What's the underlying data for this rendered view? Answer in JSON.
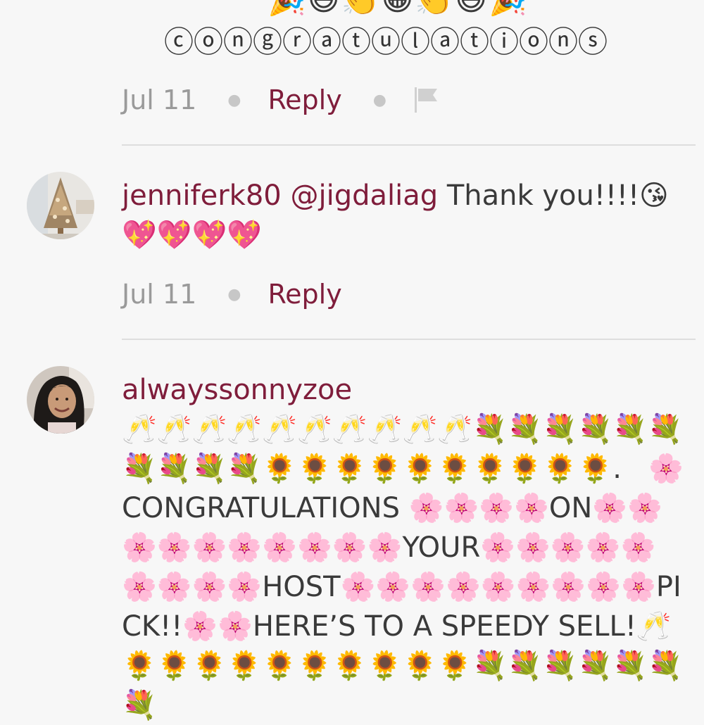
{
  "top_comment": {
    "emoji_row": "🎉😄👏😁👏😃🎉",
    "text": "ⓒⓞⓝⓖⓡⓐⓣⓤⓛⓐⓣⓘⓞⓝⓢ",
    "date": "Jul 11",
    "reply_label": "Reply",
    "icons": {
      "flag": "flag-icon"
    }
  },
  "comments": [
    {
      "username": "jenniferk80",
      "mention": "@jigdaliag",
      "text": " Thank you!!!!😘💖💖💖💖",
      "date": "Jul 11",
      "reply_label": "Reply",
      "avatar": "christmas-tree-avatar"
    },
    {
      "username": "alwayssonnyzoe",
      "text": "🥂🥂🥂🥂🥂🥂🥂🥂🥂🥂💐💐💐💐💐💐💐💐💐💐🌻🌻🌻🌻🌻🌻🌻🌻🌻🌻.   🌸CONGRATULATIONS 🌸🌸🌸🌸ON🌸🌸🌸🌸🌸🌸🌸🌸🌸🌸YOUR🌸🌸🌸🌸🌸🌸🌸🌸🌸HOST🌸🌸🌸🌸🌸🌸🌸🌸🌸PICK!!🌸🌸HERE’S TO A SPEEDY SELL!🥂 🌻🌻🌻🌻🌻🌻🌻🌻🌻🌻💐💐💐💐💐💐💐",
      "avatar": "profile-photo-avatar"
    }
  ],
  "colors": {
    "background": "#f7f7f7",
    "brand": "#7f1d3b",
    "meta_gray": "#9a9a9a",
    "divider": "#dedede",
    "text": "#3a3a3a"
  }
}
